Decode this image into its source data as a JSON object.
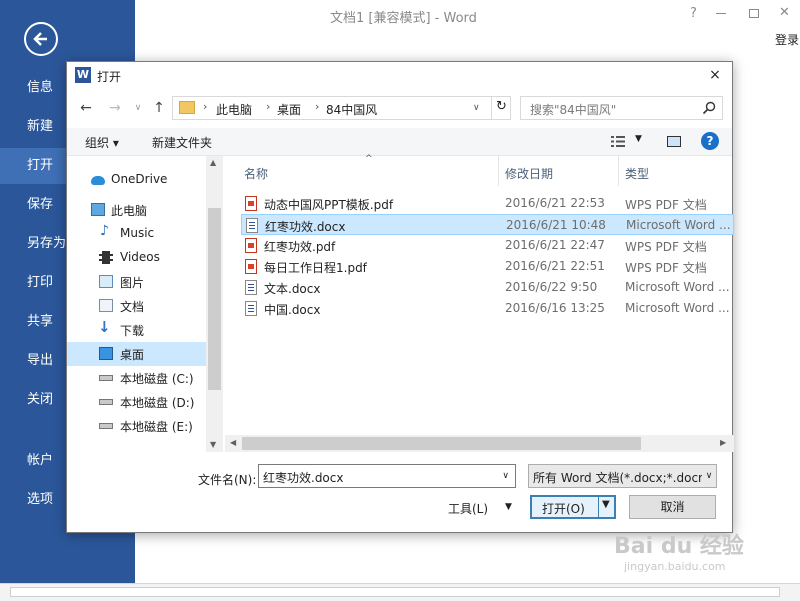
{
  "word": {
    "title": "文档1 [兼容模式] - Word",
    "help": "?",
    "login": "登录",
    "backstage": [
      "信息",
      "新建",
      "打开",
      "保存",
      "另存为",
      "打印",
      "共享",
      "导出",
      "关闭",
      "帐户",
      "选项"
    ]
  },
  "dialog": {
    "title": "打开",
    "close": "×",
    "breadcrumbs": [
      "此电脑",
      "桌面",
      "84中国风"
    ],
    "search_placeholder": "搜索\"84中国风\"",
    "toolbar": {
      "organize": "组织 ▾",
      "new_folder": "新建文件夹",
      "help": "?"
    },
    "nav": [
      {
        "label": "OneDrive",
        "icon": "cloud-icon"
      },
      {
        "label": "此电脑",
        "icon": "computer-icon"
      },
      {
        "label": "Music",
        "icon": "music-icon"
      },
      {
        "label": "Videos",
        "icon": "video-icon"
      },
      {
        "label": "图片",
        "icon": "picture-icon"
      },
      {
        "label": "文档",
        "icon": "document-icon"
      },
      {
        "label": "下载",
        "icon": "download-icon"
      },
      {
        "label": "桌面",
        "icon": "desktop-icon"
      },
      {
        "label": "本地磁盘 (C:)",
        "icon": "drive-icon"
      },
      {
        "label": "本地磁盘 (D:)",
        "icon": "drive-icon"
      },
      {
        "label": "本地磁盘 (E:)",
        "icon": "drive-icon"
      }
    ],
    "columns": {
      "name": "名称",
      "date": "修改日期",
      "type": "类型"
    },
    "files": [
      {
        "name": "动态中国风PPT模板.pdf",
        "date": "2016/6/21 22:53",
        "type": "WPS PDF 文档",
        "kind": "pdf"
      },
      {
        "name": "红枣功效.docx",
        "date": "2016/6/21 10:48",
        "type": "Microsoft Word ...",
        "kind": "doc"
      },
      {
        "name": "红枣功效.pdf",
        "date": "2016/6/21 22:47",
        "type": "WPS PDF 文档",
        "kind": "pdf"
      },
      {
        "name": "每日工作日程1.pdf",
        "date": "2016/6/21 22:51",
        "type": "WPS PDF 文档",
        "kind": "pdf"
      },
      {
        "name": "文本.docx",
        "date": "2016/6/22 9:50",
        "type": "Microsoft Word ...",
        "kind": "doc"
      },
      {
        "name": "中国.docx",
        "date": "2016/6/16 13:25",
        "type": "Microsoft Word ...",
        "kind": "doc"
      }
    ],
    "filename_label": "文件名(N):",
    "filename_value": "红枣功效.docx",
    "filter": "所有 Word 文档(*.docx;*.docm",
    "tools": "工具(L)",
    "open": "打开(O)",
    "cancel": "取消"
  },
  "watermark": {
    "main": "Bai du 经验",
    "sub": "jingyan.baidu.com"
  }
}
